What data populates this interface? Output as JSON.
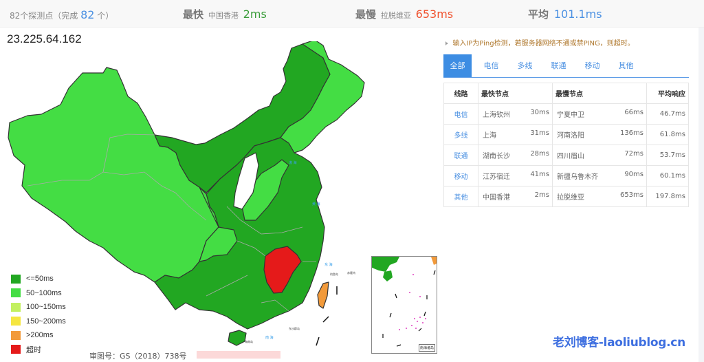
{
  "summary": {
    "probe_prefix": "82个探测点（完成",
    "probe_done": "82",
    "probe_suffix": "个）",
    "fastest_label": "最快",
    "fastest_node": "中国香港",
    "fastest_value": "2ms",
    "slowest_label": "最慢",
    "slowest_node": "拉脱维亚",
    "slowest_value": "653ms",
    "average_label": "平均",
    "average_value": "101.1ms"
  },
  "target_ip": "23.225.64.162",
  "legend": [
    {
      "label": "<=50ms",
      "color": "#22a722"
    },
    {
      "label": "50~100ms",
      "color": "#44dd44"
    },
    {
      "label": "100~150ms",
      "color": "#c3f060"
    },
    {
      "label": "150~200ms",
      "color": "#f5e640"
    },
    {
      "label": ">200ms",
      "color": "#f29a3a"
    },
    {
      "label": "超时",
      "color": "#e51a1a"
    }
  ],
  "map_caption": "审图号：GS（2018）738号",
  "inset_caption": "南海诸岛",
  "notice": {
    "icon": "speaker-icon",
    "text": "输入IP为Ping检测，若服务器网络不通或禁PING，则超时。"
  },
  "tabs": [
    "全部",
    "电信",
    "多线",
    "联通",
    "移动",
    "其他"
  ],
  "active_tab": "全部",
  "table": {
    "headers": [
      "线路",
      "最快节点",
      "最慢节点",
      "平均响应"
    ],
    "rows": [
      {
        "line": "电信",
        "fast_node": "上海钦州",
        "fast_ms": "30ms",
        "slow_node": "宁夏中卫",
        "slow_ms": "66ms",
        "avg": "46.7ms"
      },
      {
        "line": "多线",
        "fast_node": "上海",
        "fast_ms": "31ms",
        "slow_node": "河南洛阳",
        "slow_ms": "136ms",
        "avg": "61.8ms"
      },
      {
        "line": "联通",
        "fast_node": "湖南长沙",
        "fast_ms": "28ms",
        "slow_node": "四川眉山",
        "slow_ms": "72ms",
        "avg": "53.7ms"
      },
      {
        "line": "移动",
        "fast_node": "江苏宿迁",
        "fast_ms": "41ms",
        "slow_node": "新疆乌鲁木齐",
        "slow_ms": "90ms",
        "avg": "60.1ms"
      },
      {
        "line": "其他",
        "fast_node": "中国香港",
        "fast_ms": "2ms",
        "slow_node": "拉脱维亚",
        "slow_ms": "653ms",
        "avg": "197.8ms"
      }
    ]
  },
  "watermark": "老刘博客-laoliublog.cn",
  "colors": {
    "accent": "#3d8de3",
    "fast": "#3a9d3a",
    "slow": "#f0522e",
    "avg": "#4a90e2",
    "map_dark_green": "#22a722",
    "map_light_green": "#44dd44",
    "map_timeout": "#e51a1a",
    "map_over200": "#f29a3a"
  }
}
